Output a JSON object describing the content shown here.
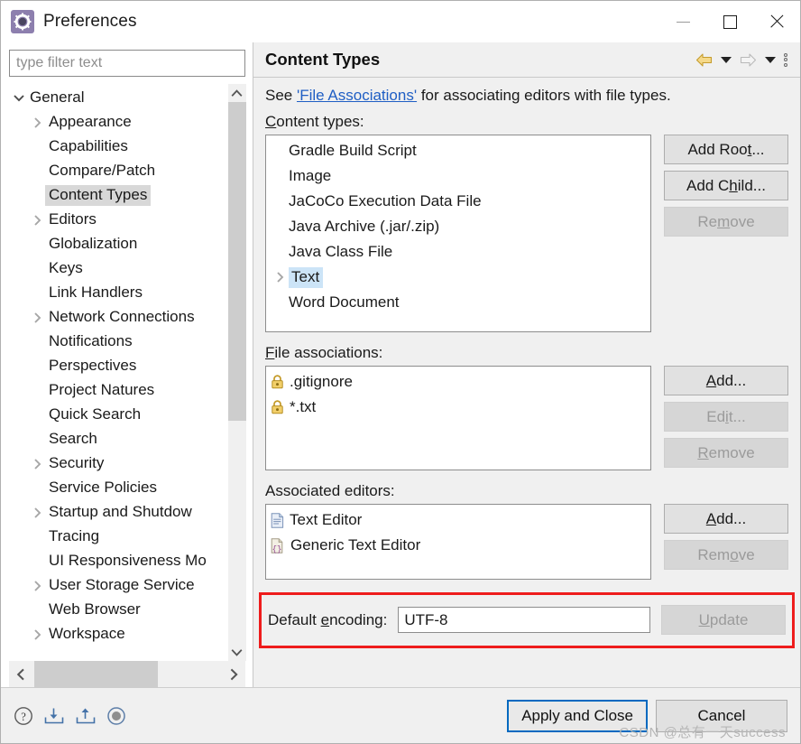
{
  "window": {
    "title": "Preferences",
    "icon": "preferences-gear-icon",
    "controls": {
      "minimize": "—",
      "maximize": "□",
      "close": "✕"
    }
  },
  "sidebar": {
    "filter": {
      "placeholder": "type filter text",
      "value": ""
    },
    "items": [
      {
        "label": "General",
        "depth": 0,
        "twisty": "down",
        "selected": false
      },
      {
        "label": "Appearance",
        "depth": 1,
        "twisty": "right",
        "selected": false
      },
      {
        "label": "Capabilities",
        "depth": 1,
        "twisty": "none",
        "selected": false
      },
      {
        "label": "Compare/Patch",
        "depth": 1,
        "twisty": "none",
        "selected": false
      },
      {
        "label": "Content Types",
        "depth": 1,
        "twisty": "none",
        "selected": true
      },
      {
        "label": "Editors",
        "depth": 1,
        "twisty": "right",
        "selected": false
      },
      {
        "label": "Globalization",
        "depth": 1,
        "twisty": "none",
        "selected": false
      },
      {
        "label": "Keys",
        "depth": 1,
        "twisty": "none",
        "selected": false
      },
      {
        "label": "Link Handlers",
        "depth": 1,
        "twisty": "none",
        "selected": false
      },
      {
        "label": "Network Connections",
        "depth": 1,
        "twisty": "right",
        "selected": false
      },
      {
        "label": "Notifications",
        "depth": 1,
        "twisty": "none",
        "selected": false
      },
      {
        "label": "Perspectives",
        "depth": 1,
        "twisty": "none",
        "selected": false
      },
      {
        "label": "Project Natures",
        "depth": 1,
        "twisty": "none",
        "selected": false
      },
      {
        "label": "Quick Search",
        "depth": 1,
        "twisty": "none",
        "selected": false
      },
      {
        "label": "Search",
        "depth": 1,
        "twisty": "none",
        "selected": false
      },
      {
        "label": "Security",
        "depth": 1,
        "twisty": "right",
        "selected": false
      },
      {
        "label": "Service Policies",
        "depth": 1,
        "twisty": "none",
        "selected": false
      },
      {
        "label": "Startup and Shutdow",
        "depth": 1,
        "twisty": "right",
        "selected": false
      },
      {
        "label": "Tracing",
        "depth": 1,
        "twisty": "none",
        "selected": false
      },
      {
        "label": "UI Responsiveness Mo",
        "depth": 1,
        "twisty": "none",
        "selected": false
      },
      {
        "label": "User Storage Service",
        "depth": 1,
        "twisty": "right",
        "selected": false
      },
      {
        "label": "Web Browser",
        "depth": 1,
        "twisty": "none",
        "selected": false
      },
      {
        "label": "Workspace",
        "depth": 1,
        "twisty": "right",
        "selected": false
      }
    ]
  },
  "panel": {
    "title": "Content Types",
    "description_prefix": "See ",
    "description_link": "'File Associations'",
    "description_suffix": " for associating editors with file types.",
    "toolbar": {
      "back": "back-arrow-icon",
      "back_menu": "back-dropdown-icon",
      "forward": "forward-arrow-icon",
      "forward_menu": "forward-dropdown-icon",
      "overflow": "view-menu-icon"
    },
    "content_types": {
      "label": "Content types:",
      "mnemonic": "C",
      "items": [
        {
          "label": "Gradle Build Script",
          "twisty": "none",
          "selected": false
        },
        {
          "label": "Image",
          "twisty": "none",
          "selected": false
        },
        {
          "label": "JaCoCo Execution Data File",
          "twisty": "none",
          "selected": false
        },
        {
          "label": "Java Archive (.jar/.zip)",
          "twisty": "none",
          "selected": false
        },
        {
          "label": "Java Class File",
          "twisty": "none",
          "selected": false
        },
        {
          "label": "Text",
          "twisty": "right",
          "selected": true
        },
        {
          "label": "Word Document",
          "twisty": "none",
          "selected": false
        }
      ],
      "buttons": [
        {
          "label": "Add Root...",
          "mnemonic": "t",
          "enabled": true
        },
        {
          "label": "Add Child...",
          "mnemonic": "h",
          "enabled": true
        },
        {
          "label": "Remove",
          "mnemonic": "m",
          "enabled": false
        }
      ]
    },
    "file_associations": {
      "label": "File associations:",
      "mnemonic": "F",
      "items": [
        {
          "label": ".gitignore",
          "icon": "lock-icon"
        },
        {
          "label": "*.txt",
          "icon": "lock-icon"
        }
      ],
      "buttons": [
        {
          "label": "Add...",
          "mnemonic": "A",
          "enabled": true
        },
        {
          "label": "Edit...",
          "mnemonic": "i",
          "enabled": false
        },
        {
          "label": "Remove",
          "mnemonic": "R",
          "enabled": false
        }
      ]
    },
    "associated_editors": {
      "label": "Associated editors:",
      "items": [
        {
          "label": "Text Editor",
          "icon": "text-editor-icon"
        },
        {
          "label": "Generic Text Editor",
          "icon": "generic-editor-icon"
        }
      ],
      "buttons": [
        {
          "label": "Add...",
          "mnemonic": "A",
          "enabled": true
        },
        {
          "label": "Remove",
          "mnemonic": "o",
          "enabled": false
        }
      ]
    },
    "encoding": {
      "label": "Default encoding:",
      "mnemonic": "e",
      "value": "UTF-8",
      "button": {
        "label": "Update",
        "mnemonic": "U",
        "enabled": false
      },
      "highlight_color": "#ee1c1c"
    }
  },
  "footer": {
    "icons": [
      {
        "name": "help-icon"
      },
      {
        "name": "import-icon"
      },
      {
        "name": "export-icon"
      },
      {
        "name": "record-icon"
      }
    ],
    "apply_and_close": "Apply and Close",
    "cancel": "Cancel",
    "watermark": "CSDN @总有一天success"
  },
  "colors": {
    "selection_blue": "#cce4f7",
    "tree_selection_gray": "#d8d8d8",
    "link_blue": "#1f5ec4",
    "focus_blue": "#0069c0",
    "annotation_red": "#ee1c1c",
    "dialog_bg": "#f0f0f0"
  }
}
